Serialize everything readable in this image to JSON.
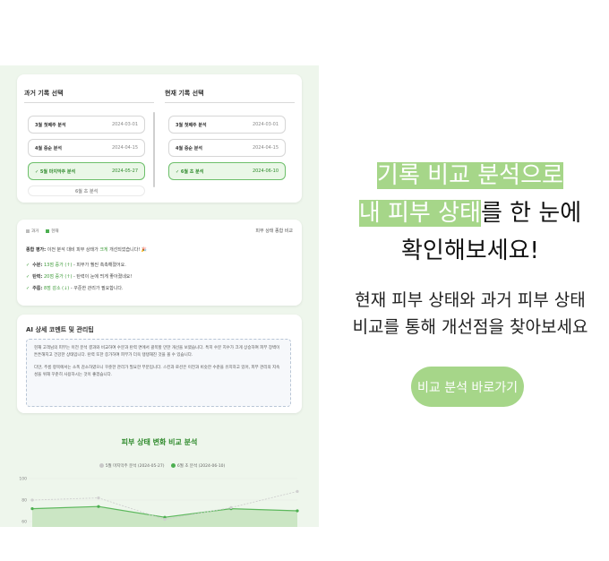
{
  "records_card": {
    "past_title": "과거 기록 선택",
    "current_title": "현재 기록 선택",
    "past_records": [
      {
        "name": "3월 첫째주 분석",
        "date": "2024-03-01",
        "selected": false
      },
      {
        "name": "4월 중순 분석",
        "date": "2024-04-15",
        "selected": false
      },
      {
        "name": "✓ 5월 마지막주 분석",
        "date": "2024-05-27",
        "selected": true
      },
      {
        "name": "6월 초 분석",
        "date": "",
        "selected": false
      }
    ],
    "current_records": [
      {
        "name": "3월 첫째주 분석",
        "date": "2024-03-01",
        "selected": false
      },
      {
        "name": "4월 중순 분석",
        "date": "2024-04-15",
        "selected": false
      },
      {
        "name": "✓ 6월 초 분석",
        "date": "2024-06-10",
        "selected": true
      }
    ]
  },
  "compare_card": {
    "legend_past": "과거",
    "legend_current": "현재",
    "title": "피부 상태 종합 비교",
    "summary_label": "종합 평가:",
    "summary_pre": "이전 분석 대비 피부 상태가",
    "summary_highlight": "크게",
    "summary_post": "개선되었습니다! 🎉",
    "items": [
      {
        "label": "수분:",
        "value": "13점 증가 (↑)",
        "desc": "- 피부가 훨씬 촉촉해졌어요."
      },
      {
        "label": "탄력:",
        "value": "20점 증가 (↑)",
        "desc": "- 탄력이 눈에 띄게 좋아졌네요!"
      },
      {
        "label": "주름:",
        "value": "8점 감소 (↓)",
        "desc": "- 꾸준한 관리가 필요합니다."
      }
    ]
  },
  "ai_card": {
    "title": "AI 상세 코멘트 및 관리팁",
    "paragraph1": "현재 고객님의 피부는 이전 분석 결과와 비교하여 수분과 탄력 면에서 괄목할 만한 개선을 보였습니다. 특히 수분 지수가 크게 상승하여 피부 장벽이 튼튼해지고 건강한 상태입니다. 탄력 또한 증가하여 피부가 더욱 탱탱해진 것을 볼 수 있습니다.",
    "paragraph2": "다만, 주름 항목에서는 소폭 감소하였으니 꾸준한 관리가 필요한 부분입니다. 스킨과 로션은 이전과 비슷한 수준을 유지하고 있어, 피부 관리의 지속성을 위해 꾸준히 사용하시는 것이 좋겠습니다."
  },
  "chart_card": {
    "title": "피부 상태 변화 비교 분석",
    "legend_past": "5월 마지막주 분석 (2024-05-27)",
    "legend_current": "6월 초 분석 (2024-06-10)"
  },
  "chart_data": {
    "type": "area",
    "title": "피부 상태 변화 비교 분석",
    "yticks": [
      "100",
      "80",
      "60"
    ],
    "ylim": [
      55,
      105
    ],
    "series": [
      {
        "name": "5월 마지막주 분석 (2024-05-27)",
        "values": [
          80,
          82,
          62,
          73,
          88
        ],
        "color": "#c8c8c8"
      },
      {
        "name": "6월 초 분석 (2024-06-10)",
        "values": [
          72,
          74,
          64,
          72,
          70
        ],
        "color": "#4caf50"
      }
    ],
    "grid": true
  },
  "promo": {
    "headline_line1": "기록 비교 분석으로",
    "headline_line2_marked": "내 피부 상태",
    "headline_line2_rest": "를 한 눈에",
    "headline_line3": "확인해보세요!",
    "subtitle_line1": "현재 피부 상태와 과거 피부 상태",
    "subtitle_line2": "비교를 통해 개선점을 찾아보세요",
    "cta_label": "비교 분석 바로가기"
  },
  "colors": {
    "accent": "#a6d689",
    "green": "#3b9a36",
    "panel_bg": "#eef6ec"
  }
}
